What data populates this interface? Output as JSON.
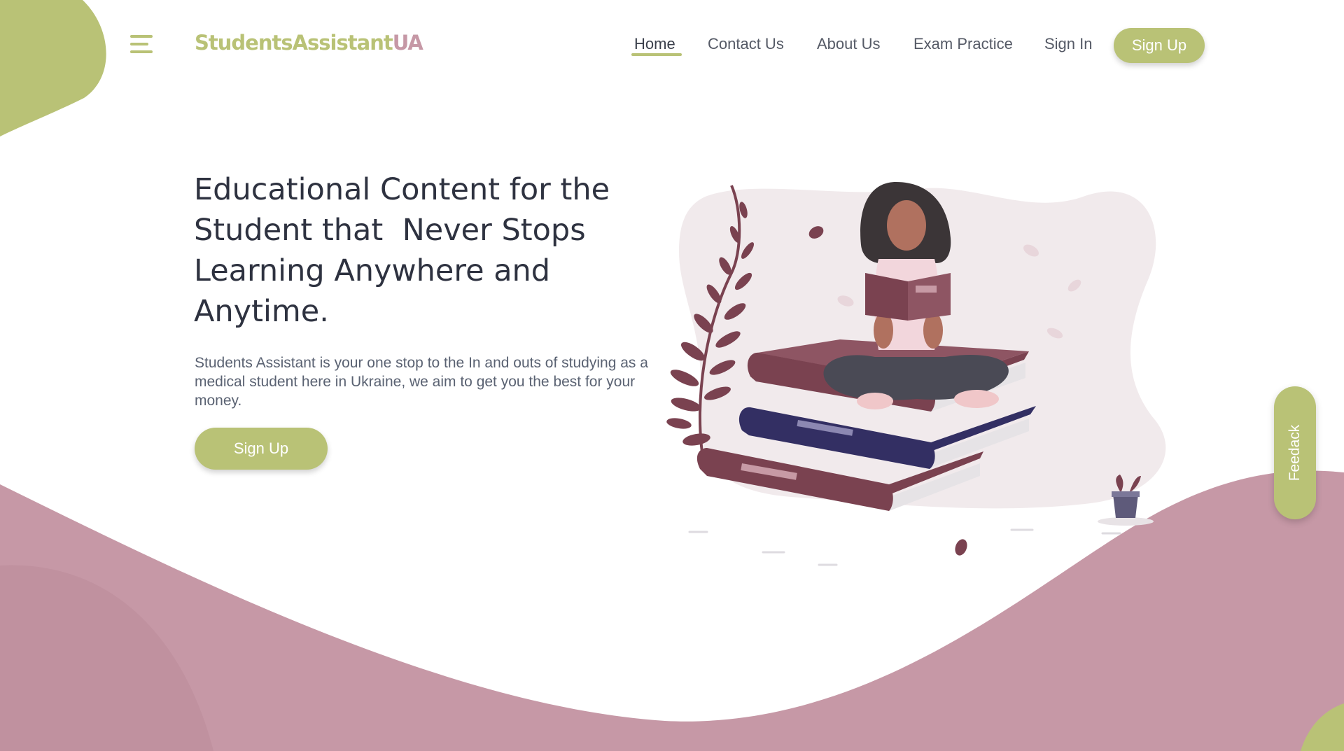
{
  "brand": {
    "name_part1": "StudentsAssistant",
    "name_part2": "UA",
    "colors": {
      "green": "#b9c276",
      "mauve": "#c698a6",
      "burgundy": "#7a4250",
      "navy": "#332f63",
      "text_dark": "#2e3240"
    }
  },
  "header": {
    "menu_icon": "hamburger-menu-icon",
    "nav": [
      {
        "label": "Home",
        "active": true
      },
      {
        "label": "Contact Us",
        "active": false
      },
      {
        "label": "About Us",
        "active": false
      },
      {
        "label": "Exam Practice",
        "active": false
      },
      {
        "label": "Sign In",
        "active": false
      }
    ],
    "signup_label": "Sign Up"
  },
  "hero": {
    "title": "Educational Content for the\nStudent that  Never Stops\nLearning Anywhere and\nAnytime.",
    "description": "Students Assistant is your one stop to the In and outs of studying as a medical student here in Ukraine, we aim to get you the best for your money.",
    "cta_label": "Sign Up",
    "illustration": "woman-reading-on-books-illustration"
  },
  "feedback": {
    "label": "Feedack"
  }
}
